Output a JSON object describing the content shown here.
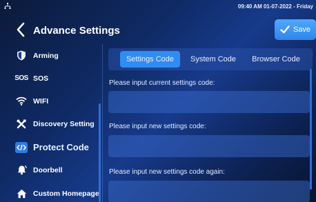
{
  "status_bar": {
    "datetime": "09:40 AM  01-07-2022 - Friday",
    "network_icon": "network-icon"
  },
  "header": {
    "title": "Advance Settings",
    "save_label": "Save",
    "back_icon": "chevron-left-icon"
  },
  "sidebar": {
    "items": [
      {
        "label": "Arming",
        "icon": "shield-icon"
      },
      {
        "label": "SOS",
        "icon": "sos-icon",
        "icon_text": "SOS"
      },
      {
        "label": "WIFI",
        "icon": "wifi-icon"
      },
      {
        "label": "Discovery Setting",
        "icon": "tools-icon"
      },
      {
        "label": "Protect Code",
        "icon": "code-icon",
        "active": true
      },
      {
        "label": "Doorbell",
        "icon": "bell-icon"
      },
      {
        "label": "Custom Homepage",
        "icon": "home-icon"
      }
    ]
  },
  "tabs": [
    {
      "label": "Settings Code",
      "active": true
    },
    {
      "label": "System Code"
    },
    {
      "label": "Browser Code"
    }
  ],
  "form": {
    "current_label": "Please input current settings code:",
    "new_label": "Please input new settings code:",
    "confirm_label": "Please input new settings code again:",
    "current_value": "",
    "new_value": "",
    "confirm_value": ""
  },
  "colors": {
    "accent": "#2f8cf2",
    "save_button": "#3d98f7",
    "active_code_icon": "#2f7be6"
  }
}
